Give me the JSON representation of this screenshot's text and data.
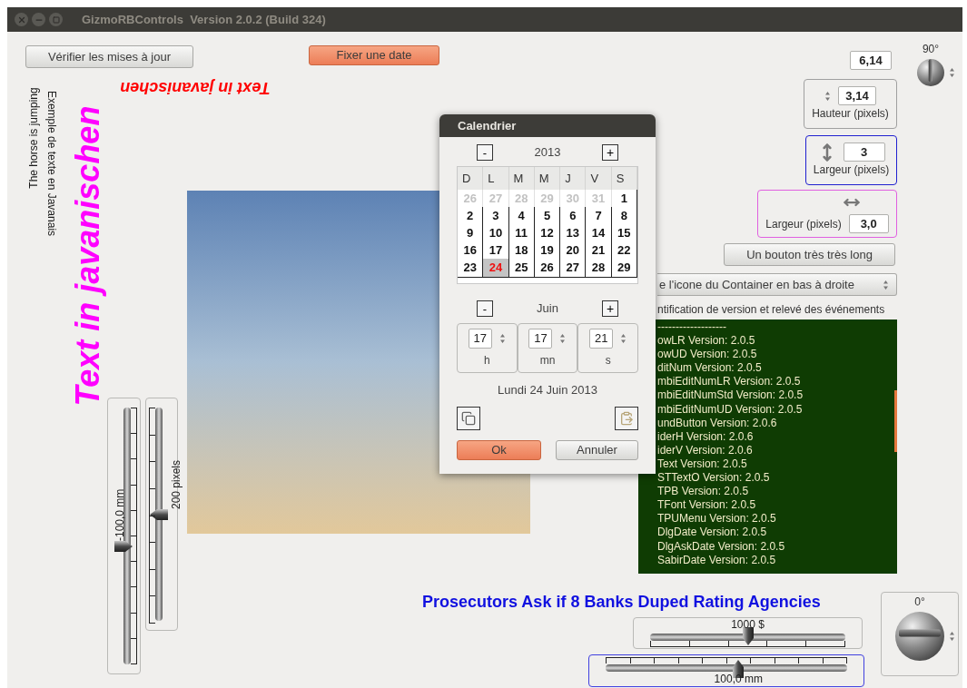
{
  "window": {
    "title": "GizmoRBControls  Version 2.0.2 (Build 324)"
  },
  "buttons": [
    {
      "label": "Vérifier les mises à jour",
      "kind": "normal"
    },
    {
      "label": "Fixer une date",
      "kind": "primary"
    }
  ],
  "rotated_texts": [
    {
      "text": "The horse is jumping",
      "kind": "up",
      "color": "#1a1a1a"
    },
    {
      "text": "Exemple de texte en Javanais",
      "kind": "down",
      "color": "#1a1a1a"
    },
    {
      "text": "Text in javanischen",
      "kind": "big_up",
      "color": "#ff00ff"
    },
    {
      "text": "Text in javanischen",
      "kind": "flipped",
      "color": "#ff0000"
    }
  ],
  "sliders_v": [
    {
      "reading": "-100,0 mm",
      "level": 0.46,
      "kind": "ticks_right"
    },
    {
      "reading": "200 pixels",
      "level": 0.5,
      "kind": "ticks_left"
    }
  ],
  "number_field": {
    "value": "6,14"
  },
  "knobs": [
    {
      "reading": "90°",
      "kind": "plain"
    },
    {
      "reading": "0°",
      "kind": "boxed"
    }
  ],
  "fields": [
    {
      "kind": "updown",
      "value": "3,14",
      "label": "Hauteur (pixels)",
      "color": "#a0a0a0"
    },
    {
      "kind": "arrow_ud",
      "value": "3",
      "label": "Largeur (pixels)",
      "color": "#2020d0"
    },
    {
      "kind": "arrow_lr",
      "value": "3,0",
      "label": "Largeur (pixels)",
      "color": "#e060e0"
    }
  ],
  "long_button": {
    "label": "Un bouton très très long"
  },
  "dropdown": {
    "value": "e l'icone du Container en bas à droite"
  },
  "log": {
    "label": "ntification de version et relevé des événements",
    "lines": [
      "-------------------",
      "owLR Version: 2.0.5",
      "owUD Version: 2.0.5",
      "ditNum Version: 2.0.5",
      "mbiEditNumLR Version: 2.0.5",
      "mbiEditNumStd Version: 2.0.5",
      "mbiEditNumUD Version: 2.0.5",
      "undButton Version: 2.0.6",
      "iderH Version: 2.0.6",
      "iderV Version: 2.0.6",
      "Text Version: 2.0.5",
      "STTextO Version: 2.0.5",
      "TPB Version: 2.0.5",
      "TFont Version: 2.0.5",
      "TPUMenu Version: 2.0.5",
      "DlgDate Version: 2.0.5",
      "DlgAskDate Version: 2.0.5",
      "SabirDate Version: 2.0.5"
    ]
  },
  "heading": "Prosecutors Ask if 8 Banks Duped Rating Agencies",
  "sliders_h": [
    {
      "reading": "1000 $",
      "level": 0.5,
      "kind": "top_label",
      "focused": false
    },
    {
      "reading": "100,0 mm",
      "level": 0.55,
      "kind": "bottom_label",
      "focused": true
    }
  ],
  "calendar": {
    "title": "Calendrier",
    "year": {
      "value": "2013",
      "prev": "-",
      "next": "+"
    },
    "weekdays": [
      "D",
      "L",
      "M",
      "M",
      "J",
      "V",
      "S"
    ],
    "weeks": [
      [
        {
          "day": "26",
          "other_month": true,
          "selected": false
        },
        {
          "day": "27",
          "other_month": true,
          "selected": false
        },
        {
          "day": "28",
          "other_month": true,
          "selected": false
        },
        {
          "day": "29",
          "other_month": true,
          "selected": false
        },
        {
          "day": "30",
          "other_month": true,
          "selected": false
        },
        {
          "day": "31",
          "other_month": true,
          "selected": false
        },
        {
          "day": "1",
          "other_month": false,
          "selected": false
        }
      ],
      [
        {
          "day": "2",
          "other_month": false,
          "selected": false
        },
        {
          "day": "3",
          "other_month": false,
          "selected": false
        },
        {
          "day": "4",
          "other_month": false,
          "selected": false
        },
        {
          "day": "5",
          "other_month": false,
          "selected": false
        },
        {
          "day": "6",
          "other_month": false,
          "selected": false
        },
        {
          "day": "7",
          "other_month": false,
          "selected": false
        },
        {
          "day": "8",
          "other_month": false,
          "selected": false
        }
      ],
      [
        {
          "day": "9",
          "other_month": false,
          "selected": false
        },
        {
          "day": "10",
          "other_month": false,
          "selected": false
        },
        {
          "day": "11",
          "other_month": false,
          "selected": false
        },
        {
          "day": "12",
          "other_month": false,
          "selected": false
        },
        {
          "day": "13",
          "other_month": false,
          "selected": false
        },
        {
          "day": "14",
          "other_month": false,
          "selected": false
        },
        {
          "day": "15",
          "other_month": false,
          "selected": false
        }
      ],
      [
        {
          "day": "16",
          "other_month": false,
          "selected": false
        },
        {
          "day": "17",
          "other_month": false,
          "selected": false
        },
        {
          "day": "18",
          "other_month": false,
          "selected": false
        },
        {
          "day": "19",
          "other_month": false,
          "selected": false
        },
        {
          "day": "20",
          "other_month": false,
          "selected": false
        },
        {
          "day": "21",
          "other_month": false,
          "selected": false
        },
        {
          "day": "22",
          "other_month": false,
          "selected": false
        }
      ],
      [
        {
          "day": "23",
          "other_month": false,
          "selected": false
        },
        {
          "day": "24",
          "other_month": false,
          "selected": true
        },
        {
          "day": "25",
          "other_month": false,
          "selected": false
        },
        {
          "day": "26",
          "other_month": false,
          "selected": false
        },
        {
          "day": "27",
          "other_month": false,
          "selected": false
        },
        {
          "day": "28",
          "other_month": false,
          "selected": false
        },
        {
          "day": "29",
          "other_month": false,
          "selected": false
        }
      ]
    ],
    "month": {
      "value": "Juin",
      "prev": "-",
      "next": "+"
    },
    "time": [
      {
        "value": "17",
        "unit": "h"
      },
      {
        "value": "17",
        "unit": "mn"
      },
      {
        "value": "21",
        "unit": "s"
      }
    ],
    "date_text": "Lundi 24 Juin 2013",
    "ok": "Ok",
    "cancel": "Annuler"
  }
}
